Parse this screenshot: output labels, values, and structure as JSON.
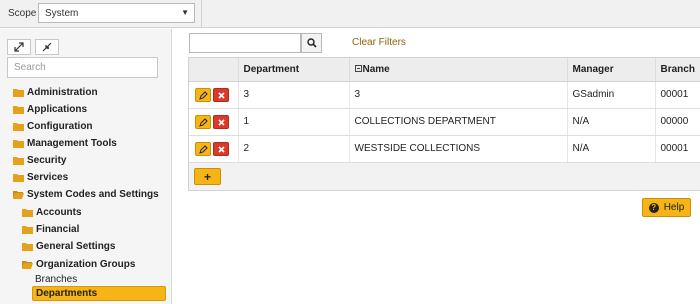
{
  "scope": {
    "label": "Scope",
    "value": "System"
  },
  "sidebar": {
    "search_placeholder": "Search",
    "tree": [
      {
        "label": "Administration"
      },
      {
        "label": "Applications"
      },
      {
        "label": "Configuration"
      },
      {
        "label": "Management Tools"
      },
      {
        "label": "Security"
      },
      {
        "label": "Services"
      },
      {
        "label": "System Codes and Settings"
      },
      {
        "label": "Accounts"
      },
      {
        "label": "Financial"
      },
      {
        "label": "General Settings"
      },
      {
        "label": "Organization Groups"
      },
      {
        "label": "Branches"
      },
      {
        "label": "Departments"
      }
    ]
  },
  "toolbar": {
    "clear_filters": "Clear Filters"
  },
  "grid": {
    "columns": [
      "Department",
      "Name",
      "Manager",
      "Branch"
    ],
    "rows": [
      {
        "department": "3",
        "name": "3",
        "manager": "GSadmin",
        "branch": "00001"
      },
      {
        "department": "1",
        "name": "COLLECTIONS DEPARTMENT",
        "manager": "N/A",
        "branch": "00000"
      },
      {
        "department": "2",
        "name": "WESTSIDE COLLECTIONS",
        "manager": "N/A",
        "branch": "00001"
      }
    ],
    "add_label": "+"
  },
  "help": {
    "label": "Help"
  },
  "colors": {
    "accent": "#f6b416",
    "delete": "#d93a2b",
    "link": "#8b6508"
  }
}
